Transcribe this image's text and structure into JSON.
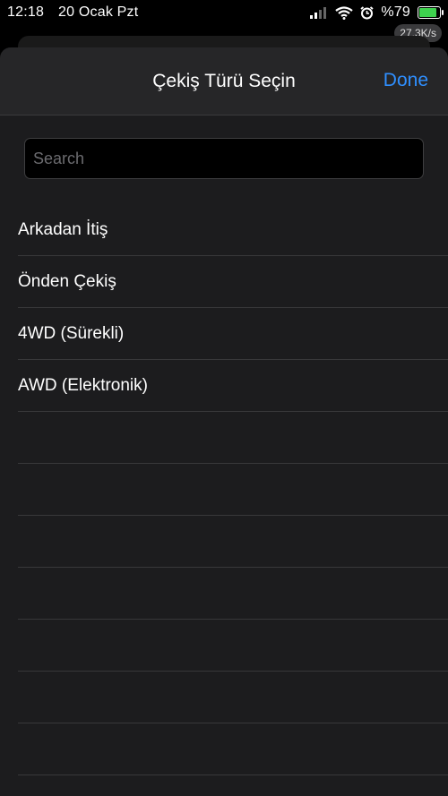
{
  "status_bar": {
    "time": "12:18",
    "date": "20 Ocak Pzt",
    "battery_percent": "%79",
    "battery_level": 0.79,
    "network_speed": "27.3K/s",
    "icons": [
      "signal-icon",
      "wifi-icon",
      "alarm-icon",
      "battery-charging-icon"
    ]
  },
  "sheet": {
    "title": "Çekiş Türü Seçin",
    "done_label": "Done"
  },
  "search": {
    "value": "",
    "placeholder": "Search"
  },
  "options": [
    {
      "label": "Arkadan İtiş"
    },
    {
      "label": "Önden Çekiş"
    },
    {
      "label": "4WD (Sürekli)"
    },
    {
      "label": "AWD (Elektronik)"
    },
    {
      "label": ""
    },
    {
      "label": ""
    },
    {
      "label": ""
    },
    {
      "label": ""
    },
    {
      "label": ""
    },
    {
      "label": ""
    },
    {
      "label": ""
    },
    {
      "label": ""
    }
  ],
  "colors": {
    "accent": "#2f8fff",
    "sheet_bg": "#1c1c1e",
    "battery_green": "#3ed24e"
  }
}
